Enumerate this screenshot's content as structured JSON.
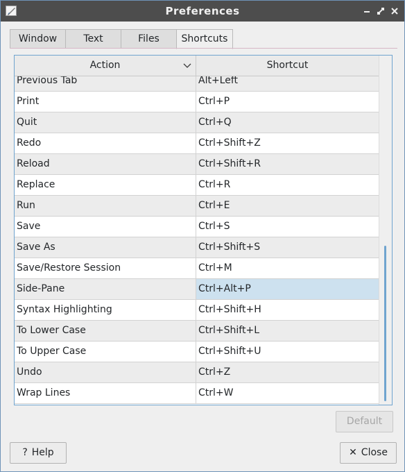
{
  "window": {
    "title": "Preferences"
  },
  "tabs": [
    {
      "label": "Window"
    },
    {
      "label": "Text"
    },
    {
      "label": "Files"
    },
    {
      "label": "Shortcuts",
      "active": true
    }
  ],
  "table": {
    "columns": {
      "action": "Action",
      "shortcut": "Shortcut"
    },
    "sort_column": "Action",
    "rows": [
      {
        "action": "Previous Tab",
        "shortcut": "Alt+Left"
      },
      {
        "action": "Print",
        "shortcut": "Ctrl+P"
      },
      {
        "action": "Quit",
        "shortcut": "Ctrl+Q"
      },
      {
        "action": "Redo",
        "shortcut": "Ctrl+Shift+Z"
      },
      {
        "action": "Reload",
        "shortcut": "Ctrl+Shift+R"
      },
      {
        "action": "Replace",
        "shortcut": "Ctrl+R"
      },
      {
        "action": "Run",
        "shortcut": "Ctrl+E"
      },
      {
        "action": "Save",
        "shortcut": "Ctrl+S"
      },
      {
        "action": "Save As",
        "shortcut": "Ctrl+Shift+S"
      },
      {
        "action": "Save/Restore Session",
        "shortcut": "Ctrl+M"
      },
      {
        "action": "Side-Pane",
        "shortcut": "Ctrl+Alt+P",
        "selected": true
      },
      {
        "action": "Syntax Highlighting",
        "shortcut": "Ctrl+Shift+H"
      },
      {
        "action": "To Lower Case",
        "shortcut": "Ctrl+Shift+L"
      },
      {
        "action": "To Upper Case",
        "shortcut": "Ctrl+Shift+U"
      },
      {
        "action": "Undo",
        "shortcut": "Ctrl+Z"
      },
      {
        "action": "Wrap Lines",
        "shortcut": "Ctrl+W"
      }
    ]
  },
  "buttons": {
    "default": "Default",
    "help": "Help",
    "close": "Close"
  },
  "icons": {
    "app": "app-icon",
    "minimize": "minimize-icon",
    "maximize": "maximize-icon",
    "close": "close-icon",
    "sort": "chevron-down-icon",
    "help": "question-icon",
    "close_button": "x-icon"
  },
  "colors": {
    "titlebar": "#4d4d4d",
    "accent": "#6fa4cf",
    "selection": "#cde1ef"
  }
}
